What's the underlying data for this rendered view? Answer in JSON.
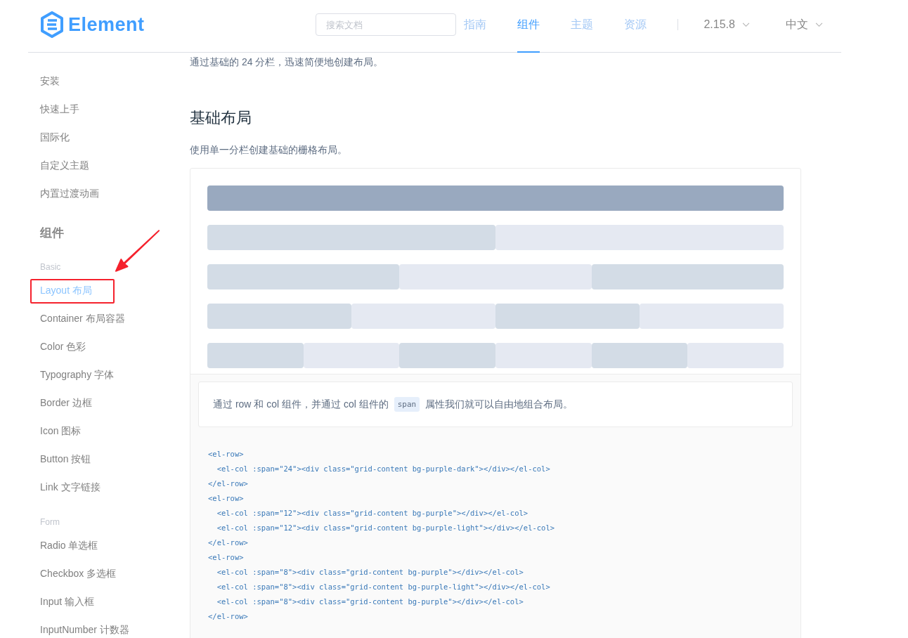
{
  "header": {
    "logo_text": "Element",
    "search": {
      "placeholder": "搜索文档"
    },
    "nav": [
      {
        "label": "指南",
        "selected": false
      },
      {
        "label": "组件",
        "selected": true
      },
      {
        "label": "主题",
        "selected": false
      },
      {
        "label": "资源",
        "selected": false
      }
    ],
    "version": "2.15.8",
    "language": "中文"
  },
  "sidebar": {
    "items": [
      {
        "kind": "item",
        "label": "安装",
        "selected": false,
        "highlighted": false
      },
      {
        "kind": "item",
        "label": "快速上手",
        "selected": false,
        "highlighted": false
      },
      {
        "kind": "item",
        "label": "国际化",
        "selected": false,
        "highlighted": false
      },
      {
        "kind": "item",
        "label": "自定义主题",
        "selected": false,
        "highlighted": false
      },
      {
        "kind": "item",
        "label": "内置过渡动画",
        "selected": false,
        "highlighted": false
      },
      {
        "kind": "section",
        "label": "组件"
      },
      {
        "kind": "group",
        "label": "Basic"
      },
      {
        "kind": "item",
        "label": "Layout 布局",
        "selected": true,
        "highlighted": true
      },
      {
        "kind": "item",
        "label": "Container 布局容器",
        "selected": false,
        "highlighted": false
      },
      {
        "kind": "item",
        "label": "Color 色彩",
        "selected": false,
        "highlighted": false
      },
      {
        "kind": "item",
        "label": "Typography 字体",
        "selected": false,
        "highlighted": false
      },
      {
        "kind": "item",
        "label": "Border 边框",
        "selected": false,
        "highlighted": false
      },
      {
        "kind": "item",
        "label": "Icon 图标",
        "selected": false,
        "highlighted": false
      },
      {
        "kind": "item",
        "label": "Button 按钮",
        "selected": false,
        "highlighted": false
      },
      {
        "kind": "item",
        "label": "Link 文字链接",
        "selected": false,
        "highlighted": false
      },
      {
        "kind": "group",
        "label": "Form"
      },
      {
        "kind": "item",
        "label": "Radio 单选框",
        "selected": false,
        "highlighted": false
      },
      {
        "kind": "item",
        "label": "Checkbox 多选框",
        "selected": false,
        "highlighted": false
      },
      {
        "kind": "item",
        "label": "Input 输入框",
        "selected": false,
        "highlighted": false
      },
      {
        "kind": "item",
        "label": "InputNumber 计数器",
        "selected": false,
        "highlighted": false
      }
    ]
  },
  "content": {
    "intro": "通过基础的 24 分栏，迅速简便地创建布局。",
    "heading": "基础布局",
    "subtitle": "使用单一分栏创建基础的栅格布局。",
    "demo_rows": [
      {
        "cols": [
          {
            "color": "#99a9bf"
          }
        ]
      },
      {
        "cols": [
          {
            "color": "#d3dce6"
          },
          {
            "color": "#e5e9f2"
          }
        ]
      },
      {
        "cols": [
          {
            "color": "#d3dce6"
          },
          {
            "color": "#e5e9f2"
          },
          {
            "color": "#d3dce6"
          }
        ]
      },
      {
        "cols": [
          {
            "color": "#d3dce6"
          },
          {
            "color": "#e5e9f2"
          },
          {
            "color": "#d3dce6"
          },
          {
            "color": "#e5e9f2"
          }
        ]
      },
      {
        "cols": [
          {
            "color": "#d3dce6"
          },
          {
            "color": "#e5e9f2"
          },
          {
            "color": "#d3dce6"
          },
          {
            "color": "#e5e9f2"
          },
          {
            "color": "#d3dce6"
          },
          {
            "color": "#e5e9f2"
          }
        ]
      }
    ],
    "description": {
      "before": "通过 row 和 col 组件，并通过 col 组件的",
      "code": "span",
      "after": "属性我们就可以自由地组合布局。"
    },
    "code_lines": [
      "<el-row>",
      "  <el-col :span=\"24\"><div class=\"grid-content bg-purple-dark\"></div></el-col>",
      "</el-row>",
      "<el-row>",
      "  <el-col :span=\"12\"><div class=\"grid-content bg-purple\"></div></el-col>",
      "  <el-col :span=\"12\"><div class=\"grid-content bg-purple-light\"></div></el-col>",
      "</el-row>",
      "<el-row>",
      "  <el-col :span=\"8\"><div class=\"grid-content bg-purple\"></div></el-col>",
      "  <el-col :span=\"8\"><div class=\"grid-content bg-purple-light\"></div></el-col>",
      "  <el-col :span=\"8\"><div class=\"grid-content bg-purple\"></div></el-col>",
      "</el-row>"
    ]
  }
}
